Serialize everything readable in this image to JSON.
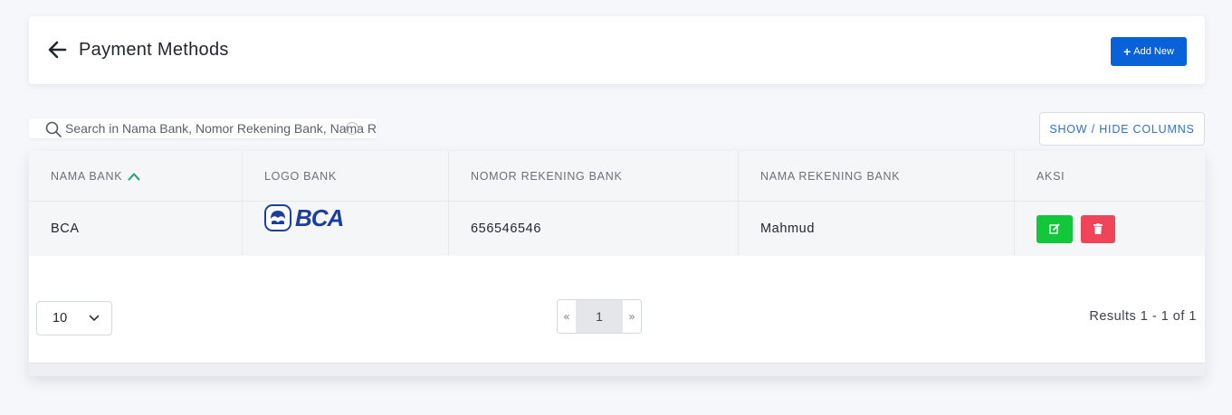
{
  "header": {
    "title": "Payment Methods",
    "add_button_label": "Add New"
  },
  "search": {
    "placeholder": "Search in Nama Bank, Nomor Rekening Bank, Nama Rekening Bank"
  },
  "toolbar": {
    "show_hide_label": "SHOW / HIDE COLUMNS"
  },
  "table": {
    "columns": [
      "NAMA BANK",
      "LOGO BANK",
      "NOMOR REKENING BANK",
      "NAMA REKENING BANK",
      "AKSI"
    ],
    "sorted_column": "NAMA BANK",
    "sort_direction": "ascending",
    "rows": [
      {
        "nama_bank": "BCA",
        "logo_text": "BCA",
        "nomor_rekening": "656546546",
        "nama_rekening": "Mahmud"
      }
    ]
  },
  "pagination": {
    "per_page": "10",
    "prev": "«",
    "current_page": "1",
    "next": "»",
    "results_text": "Results 1 - 1 of 1"
  },
  "colors": {
    "primary": "#0a62d8",
    "edit": "#12c83a",
    "delete": "#f04458",
    "sort_indicator": "#1aa36b",
    "bca_blue": "#1b3f9a"
  },
  "icons": [
    "arrow-left-icon",
    "plus-icon",
    "search-icon",
    "clear-icon",
    "chevron-up-icon",
    "edit-icon",
    "trash-icon",
    "chevron-down-icon"
  ]
}
